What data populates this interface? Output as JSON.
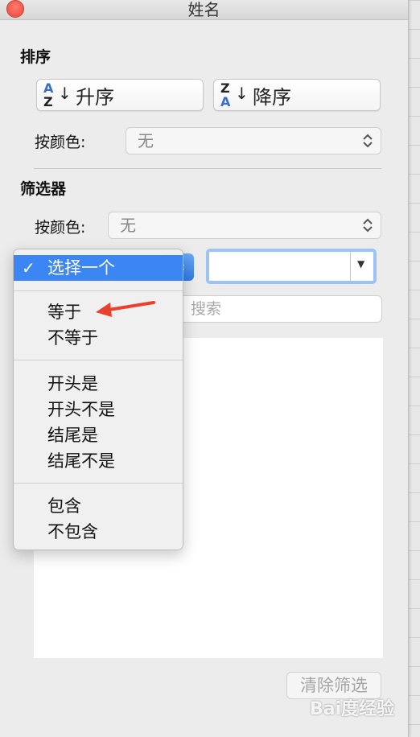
{
  "window": {
    "title": "姓名"
  },
  "sort": {
    "section_label": "排序",
    "ascending": {
      "letter_top": "A",
      "letter_bottom": "Z",
      "label": "升序"
    },
    "descending": {
      "letter_top": "Z",
      "letter_bottom": "A",
      "label": "降序"
    },
    "by_color_label": "按颜色:",
    "by_color_value": "无"
  },
  "filter": {
    "section_label": "筛选器",
    "by_color_label": "按颜色:",
    "by_color_value": "无",
    "search_placeholder": "搜索",
    "clear_label": "清除筛选"
  },
  "menu": {
    "selected": "选择一个",
    "groups": [
      [
        "等于",
        "不等于"
      ],
      [
        "开头是",
        "开头不是",
        "结尾是",
        "结尾不是"
      ],
      [
        "包含",
        "不包含"
      ]
    ]
  },
  "watermark": "Bai度经验",
  "colors": {
    "accent": "#3c86f3",
    "close_button": "#e5483b",
    "annotation_arrow": "#e8412c"
  }
}
